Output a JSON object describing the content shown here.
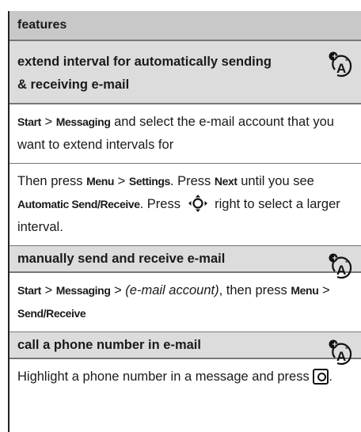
{
  "header": {
    "title": "features"
  },
  "sections": [
    {
      "title_line1": "extend interval for automatically sending",
      "title_line2": "& receiving e-mail",
      "icon": "operator-feature-icon",
      "p1": {
        "start": "Start",
        "sep1": " > ",
        "messaging": "Messaging",
        "rest": " and select the e-mail account that you want to extend intervals for"
      },
      "p2": {
        "then": "Then press ",
        "menu": "Menu",
        "sep": " > ",
        "settings": "Settings",
        "press": ". Press ",
        "next": "Next",
        "until": " until you see ",
        "auto": "Automatic Send/Receive",
        "press2": ". Press ",
        "nav_icon": "navigation-key-icon",
        "right": " right to select a larger interval."
      }
    },
    {
      "title": "manually send and receive e-mail",
      "icon": "operator-feature-icon",
      "p1": {
        "start": "Start",
        "sep1": " > ",
        "messaging": "Messaging",
        "sep2": " > ",
        "account": "(e-mail account)",
        "then": ", then press ",
        "menu": "Menu",
        "sep3": " > ",
        "sendreceive": "Send/Receive"
      }
    },
    {
      "title": "call a phone number in e-mail",
      "icon": "operator-feature-icon",
      "p1": {
        "text": "Highlight a phone number in a message and press ",
        "key_icon": "center-select-key-icon",
        "end": "."
      }
    }
  ]
}
